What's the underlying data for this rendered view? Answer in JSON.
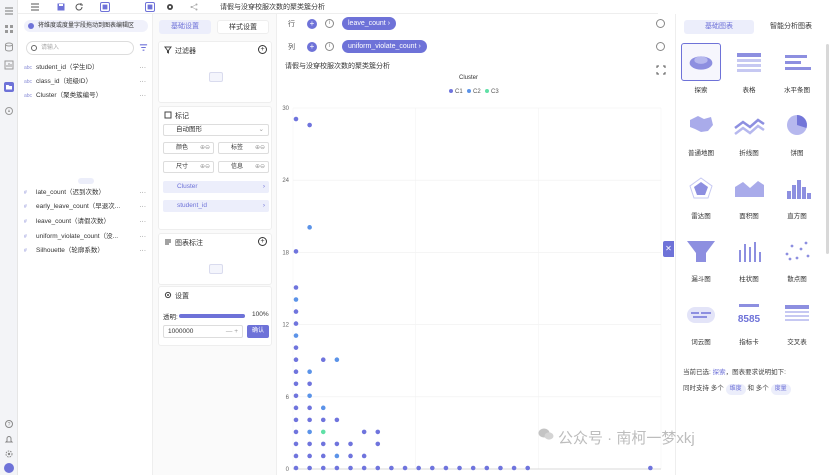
{
  "toolbar": {
    "title": "请假与没穿校服次数的聚类簇分析"
  },
  "field_panel": {
    "hint": "将维度或度量字段拖动到图表编辑区",
    "search_placeholder": "请输入",
    "dimensions": [
      {
        "type": "abc",
        "name": "student_id（学生ID）"
      },
      {
        "type": "abc",
        "name": "class_id（班级ID）"
      },
      {
        "type": "abc",
        "name": "Cluster（聚类簇编号）"
      }
    ],
    "measures": [
      {
        "type": "#",
        "name": "late_count（迟到次数）"
      },
      {
        "type": "#",
        "name": "early_leave_count（早退次..."
      },
      {
        "type": "#",
        "name": "leave_count（请假次数）"
      },
      {
        "type": "#",
        "name": "uniform_violate_count（没..."
      },
      {
        "type": "#",
        "name": "Silhouette（轮廓系数）"
      }
    ],
    "more": "···"
  },
  "config": {
    "tabs": [
      "基础设置",
      "样式设置"
    ],
    "filter_title": "过滤器",
    "mark_title": "标记",
    "mark_type": "自动图形",
    "mark_chips": [
      "颜色",
      "标签",
      "尺寸",
      "信息"
    ],
    "mark_fields": [
      "Cluster",
      "student_id"
    ],
    "annotation_title": "图表标注",
    "settings_title": "设置",
    "opacity_label": "透明:",
    "opacity_value": "100%",
    "opacity": 1.0,
    "limit_value": "1000000",
    "confirm": "确认"
  },
  "shelves": {
    "row_label": "行",
    "row_field": "leave_count",
    "col_label": "列",
    "col_field": "uniform_violate_count"
  },
  "chart_data": {
    "type": "scatter",
    "title": "请假与没穿校服次数的聚类簇分析",
    "legend_title": "Cluster",
    "legend_position": "top",
    "series": [
      {
        "name": "C1",
        "color": "#6f74dd"
      },
      {
        "name": "C2",
        "color": "#5b93e8"
      },
      {
        "name": "C3",
        "color": "#5fe0a6"
      }
    ],
    "y_ticks": [
      "0",
      "6",
      "12",
      "18",
      "24",
      "30"
    ],
    "ylim": [
      0,
      30
    ],
    "xlim": [
      0,
      27
    ],
    "grid": true,
    "points": [
      {
        "x": 0,
        "y": 29,
        "s": 0
      },
      {
        "x": 1,
        "y": 28.5,
        "s": 0
      },
      {
        "x": 1,
        "y": 20,
        "s": 1
      },
      {
        "x": 0,
        "y": 18,
        "s": 0
      },
      {
        "x": 0,
        "y": 15,
        "s": 0
      },
      {
        "x": 0,
        "y": 14,
        "s": 1
      },
      {
        "x": 0,
        "y": 13,
        "s": 0
      },
      {
        "x": 0,
        "y": 12,
        "s": 0
      },
      {
        "x": 0,
        "y": 11,
        "s": 1
      },
      {
        "x": 0,
        "y": 10,
        "s": 0
      },
      {
        "x": 0,
        "y": 9,
        "s": 0
      },
      {
        "x": 2,
        "y": 9,
        "s": 0
      },
      {
        "x": 3,
        "y": 9,
        "s": 1
      },
      {
        "x": 0,
        "y": 8,
        "s": 0
      },
      {
        "x": 1,
        "y": 8,
        "s": 1
      },
      {
        "x": 0,
        "y": 7,
        "s": 0
      },
      {
        "x": 1,
        "y": 7,
        "s": 0
      },
      {
        "x": 0,
        "y": 6,
        "s": 0
      },
      {
        "x": 1,
        "y": 6,
        "s": 1
      },
      {
        "x": 0,
        "y": 5,
        "s": 0
      },
      {
        "x": 1,
        "y": 5,
        "s": 0
      },
      {
        "x": 2,
        "y": 5,
        "s": 1
      },
      {
        "x": 0,
        "y": 4,
        "s": 0
      },
      {
        "x": 1,
        "y": 4,
        "s": 0
      },
      {
        "x": 2,
        "y": 4,
        "s": 0
      },
      {
        "x": 3,
        "y": 4,
        "s": 0
      },
      {
        "x": 0,
        "y": 3,
        "s": 0
      },
      {
        "x": 1,
        "y": 3,
        "s": 1
      },
      {
        "x": 2,
        "y": 3,
        "s": 2
      },
      {
        "x": 5,
        "y": 3,
        "s": 0
      },
      {
        "x": 6,
        "y": 3,
        "s": 0
      },
      {
        "x": 0,
        "y": 2,
        "s": 0
      },
      {
        "x": 1,
        "y": 2,
        "s": 0
      },
      {
        "x": 2,
        "y": 2,
        "s": 0
      },
      {
        "x": 3,
        "y": 2,
        "s": 0
      },
      {
        "x": 4,
        "y": 2,
        "s": 0
      },
      {
        "x": 6,
        "y": 2,
        "s": 0
      },
      {
        "x": 0,
        "y": 1,
        "s": 0
      },
      {
        "x": 1,
        "y": 1,
        "s": 0
      },
      {
        "x": 2,
        "y": 1,
        "s": 0
      },
      {
        "x": 3,
        "y": 1,
        "s": 1
      },
      {
        "x": 4,
        "y": 1,
        "s": 0
      },
      {
        "x": 5,
        "y": 1,
        "s": 0
      },
      {
        "x": 0,
        "y": 0,
        "s": 0
      },
      {
        "x": 1,
        "y": 0,
        "s": 0
      },
      {
        "x": 2,
        "y": 0,
        "s": 0
      },
      {
        "x": 3,
        "y": 0,
        "s": 0
      },
      {
        "x": 4,
        "y": 0,
        "s": 0
      },
      {
        "x": 5,
        "y": 0,
        "s": 0
      },
      {
        "x": 6,
        "y": 0,
        "s": 0
      },
      {
        "x": 7,
        "y": 0,
        "s": 0
      },
      {
        "x": 8,
        "y": 0,
        "s": 0
      },
      {
        "x": 9,
        "y": 0,
        "s": 0
      },
      {
        "x": 10,
        "y": 0,
        "s": 0
      },
      {
        "x": 11,
        "y": 0,
        "s": 0
      },
      {
        "x": 12,
        "y": 0,
        "s": 0
      },
      {
        "x": 13,
        "y": 0,
        "s": 0
      },
      {
        "x": 14,
        "y": 0,
        "s": 0
      },
      {
        "x": 15,
        "y": 0,
        "s": 0
      },
      {
        "x": 16,
        "y": 0,
        "s": 0
      },
      {
        "x": 17,
        "y": 0,
        "s": 0
      },
      {
        "x": 26,
        "y": 0,
        "s": 0
      }
    ]
  },
  "right_panel": {
    "tabs": [
      "基础图表",
      "智能分析图表"
    ],
    "chart_types": [
      {
        "label": "探索",
        "icon": "explore-icon",
        "selected": true
      },
      {
        "label": "表格",
        "icon": "table-chart-icon"
      },
      {
        "label": "水平条图",
        "icon": "hbar-chart-icon"
      },
      {
        "label": "普通地图",
        "icon": "map-chart-icon"
      },
      {
        "label": "折线图",
        "icon": "line-chart-icon"
      },
      {
        "label": "饼图",
        "icon": "pie-chart-icon"
      },
      {
        "label": "雷达图",
        "icon": "radar-chart-icon"
      },
      {
        "label": "面积图",
        "icon": "area-chart-icon"
      },
      {
        "label": "直方图",
        "icon": "histogram-chart-icon"
      },
      {
        "label": "漏斗图",
        "icon": "funnel-chart-icon"
      },
      {
        "label": "柱状图",
        "icon": "bar-chart-icon"
      },
      {
        "label": "散点图",
        "icon": "scatter-chart-icon"
      },
      {
        "label": "词云图",
        "icon": "wordcloud-chart-icon"
      },
      {
        "label": "指标卡",
        "icon": "kpi-card-icon",
        "kpi_text": "8585"
      },
      {
        "label": "交叉表",
        "icon": "crosstab-chart-icon"
      }
    ],
    "desc_prefix": "当前已选:",
    "desc_selected": "探索",
    "desc_suffix": "，图表要求说明如下:",
    "support_prefix": "同时支持 多个",
    "support_dim": "维度",
    "support_mid": "和 多个",
    "support_measure": "度量"
  },
  "watermark": "公众号 · 南柯一梦xkj",
  "colors": {
    "accent": "#6e72d8"
  }
}
